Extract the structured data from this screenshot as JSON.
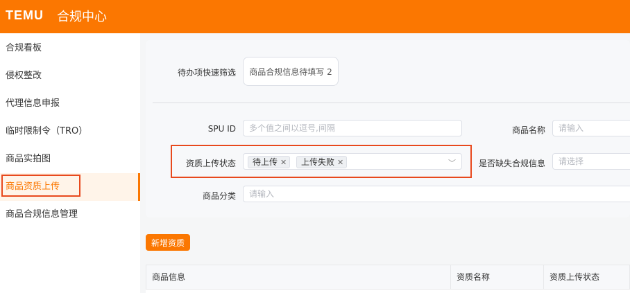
{
  "header": {
    "brand": "TEMU",
    "title": "合规中心"
  },
  "sidebar": {
    "items": [
      {
        "label": "合规看板"
      },
      {
        "label": "侵权整改"
      },
      {
        "label": "代理信息申报"
      },
      {
        "label": "临时限制令（TRO）"
      },
      {
        "label": "商品实拍图"
      },
      {
        "label": "商品资质上传",
        "active": true
      },
      {
        "label": "商品合规信息管理"
      }
    ]
  },
  "filters": {
    "quick_filter_label": "待办项快速筛选",
    "quick_filter_chip": "商品合规信息待填写 2",
    "spu_label": "SPU ID",
    "spu_placeholder": "多个值之间以逗号,间隔",
    "product_name_label": "商品名称",
    "product_name_placeholder": "请输入",
    "upload_status_label": "资质上传状态",
    "upload_status_tags": [
      "待上传",
      "上传失败"
    ],
    "missing_info_label": "是否缺失合规信息",
    "missing_info_placeholder": "请选择",
    "category_label": "商品分类",
    "category_placeholder": "请输入"
  },
  "actions": {
    "add_label": "新增资质"
  },
  "table": {
    "columns": [
      "商品信息",
      "资质名称",
      "资质上传状态"
    ]
  },
  "colors": {
    "brand": "#fb7701",
    "highlight": "#e8491d"
  }
}
